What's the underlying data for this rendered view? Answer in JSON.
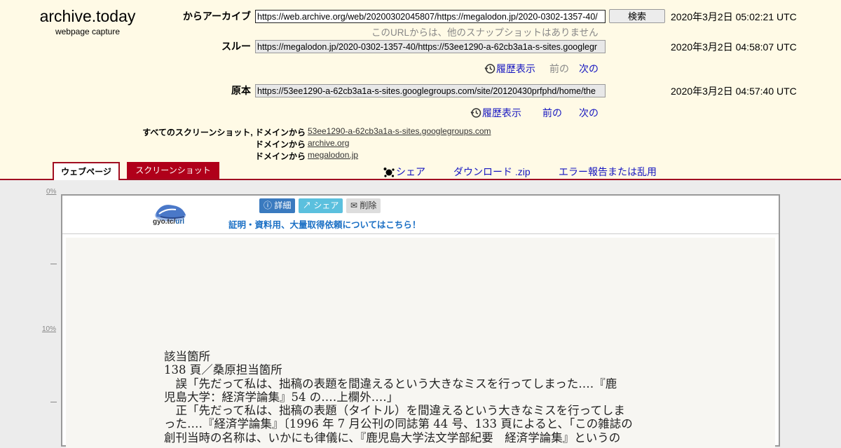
{
  "logo": {
    "name": "archive.today",
    "sub": "webpage capture"
  },
  "rows": {
    "from_archive": {
      "label": "からアーカイブ",
      "url": "https://web.archive.org/web/20200302045807/https://megalodon.jp/2020-0302-1357-40/",
      "date": "2020年3月2日 05:02:21 UTC"
    },
    "search_button": "検索",
    "no_other_snapshots": "このURLからは、他のスナップショットはありません",
    "through": {
      "label": "スルー",
      "url": "https://megalodon.jp/2020-0302-1357-40/https://53ee1290-a-62cb3a1a-s-sites.googlegr",
      "date": "2020年3月2日 04:58:07 UTC"
    },
    "through_nav": {
      "history": "履歴表示",
      "prev": "前の",
      "next": "次の"
    },
    "original": {
      "label": "原本",
      "url": "https://53ee1290-a-62cb3a1a-s-sites.googlegroups.com/site/20120430prfphd/home/the",
      "date": "2020年3月2日 04:57:40 UTC"
    },
    "original_nav": {
      "history": "履歴表示",
      "prev": "前の",
      "next": "次の"
    }
  },
  "screenshots": {
    "all_label": "すべてのスクリーンショット, ドメインから",
    "domain_label": "ドメインから",
    "domains": [
      "53ee1290-a-62cb3a1a-s-sites.googlegroups.com",
      "archive.org",
      "megalodon.jp"
    ]
  },
  "tabs": {
    "webpage": "ウェブページ",
    "screenshot": "スクリーンショット"
  },
  "actions": {
    "share": "シェア",
    "download": "ダウンロード .zip",
    "report": "エラー報告または乱用"
  },
  "scroll_markers": [
    "0%",
    "10%"
  ],
  "capture": {
    "gyo_logo_text": "gyo.tc/",
    "gyo_logo_url": "url",
    "buttons": {
      "detail": "詳細",
      "share": "シェア",
      "delete": "削除"
    },
    "promo_link": "証明・資料用、大量取得依頼についてはこちら！",
    "document_lines": [
      "該当箇所",
      "138 頁／桑原担当箇所",
      "　誤「先だって私は、拙稿の表題を間違えるという大きなミスを行ってしまった‥‥『鹿",
      "児島大学：経済学論集』54 の‥‥上欄外‥‥」",
      "　正「先だって私は、拙稿の表題（タイトル）を間違えるという大きなミスを行ってしま",
      "った‥‥『経済学論集』〔1996 年 7 月公刊の同誌第 44 号、133 頁によると、「この雑誌の",
      "創刊当時の名称は、いかにも律儀に、『鹿児島大学法文学部紀要　経済学論集』というの"
    ]
  },
  "colors": {
    "header_bg": "#fffae6",
    "accent": "#a10e22",
    "link": "#1515c0"
  }
}
